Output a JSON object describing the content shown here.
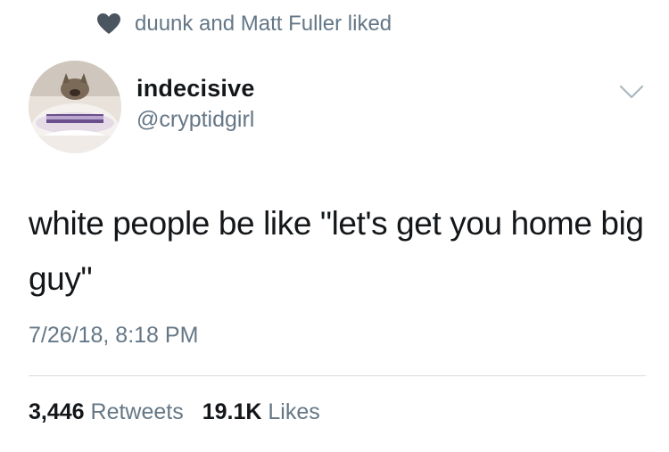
{
  "social_context": {
    "icon": "heart-icon",
    "text": "duunk and Matt Fuller liked"
  },
  "author": {
    "display_name": "indecisive",
    "handle": "@cryptidgirl",
    "avatar": "cat-in-laundry-basket"
  },
  "tweet": {
    "text": "white people be like \"let's get you home big guy\"",
    "timestamp": "7/26/18, 8:18 PM"
  },
  "stats": {
    "retweets_count": "3,446",
    "retweets_label": "Retweets",
    "likes_count": "19.1K",
    "likes_label": "Likes"
  },
  "colors": {
    "primary_text": "#14171a",
    "secondary_text": "#657786",
    "divider": "#d6dce0",
    "heart": "#4a5560"
  }
}
